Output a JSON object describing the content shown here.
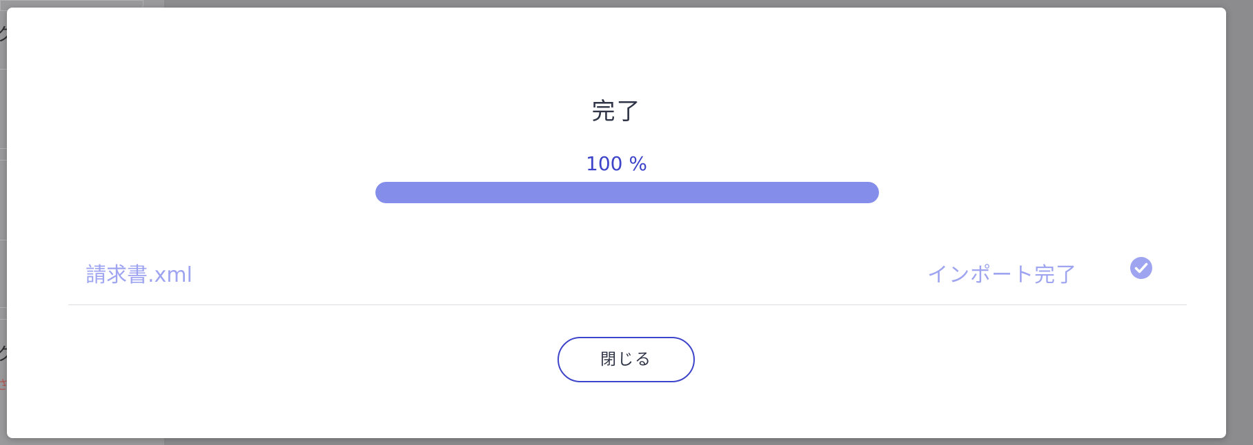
{
  "background": {
    "glyphs": [
      "ク",
      "ク"
    ],
    "red_text": "さ"
  },
  "dialog": {
    "title": "完了",
    "progress": {
      "label": "100 %",
      "value": 1.0
    },
    "file": {
      "name": "請求書.xml",
      "status": "インポート完了",
      "status_icon": "check-circle-icon"
    },
    "close_button_label": "閉じる"
  },
  "colors": {
    "accent": "#3d44c9",
    "progress_fill": "#858deb",
    "muted_accent": "#9ea4f0",
    "title": "#2f3446",
    "overlay": "#8c8c8e"
  }
}
